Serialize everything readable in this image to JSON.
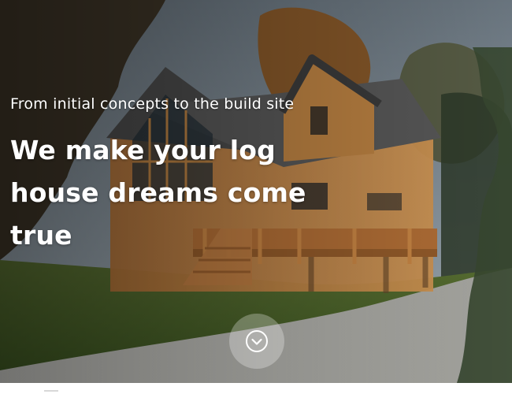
{
  "hero": {
    "subtitle": "From initial concepts to the build site",
    "headline": "We make your log house dreams come true",
    "background_image": "log-house-photo",
    "scroll_icon": "chevron-down-circle-icon"
  },
  "colors": {
    "text": "#ffffff",
    "button_bg": "rgba(255,255,255,0.28)",
    "wood": "#c98a45",
    "roof": "#5a5a5a",
    "grass": "#4f6a2d",
    "gravel": "#bfbfba"
  }
}
